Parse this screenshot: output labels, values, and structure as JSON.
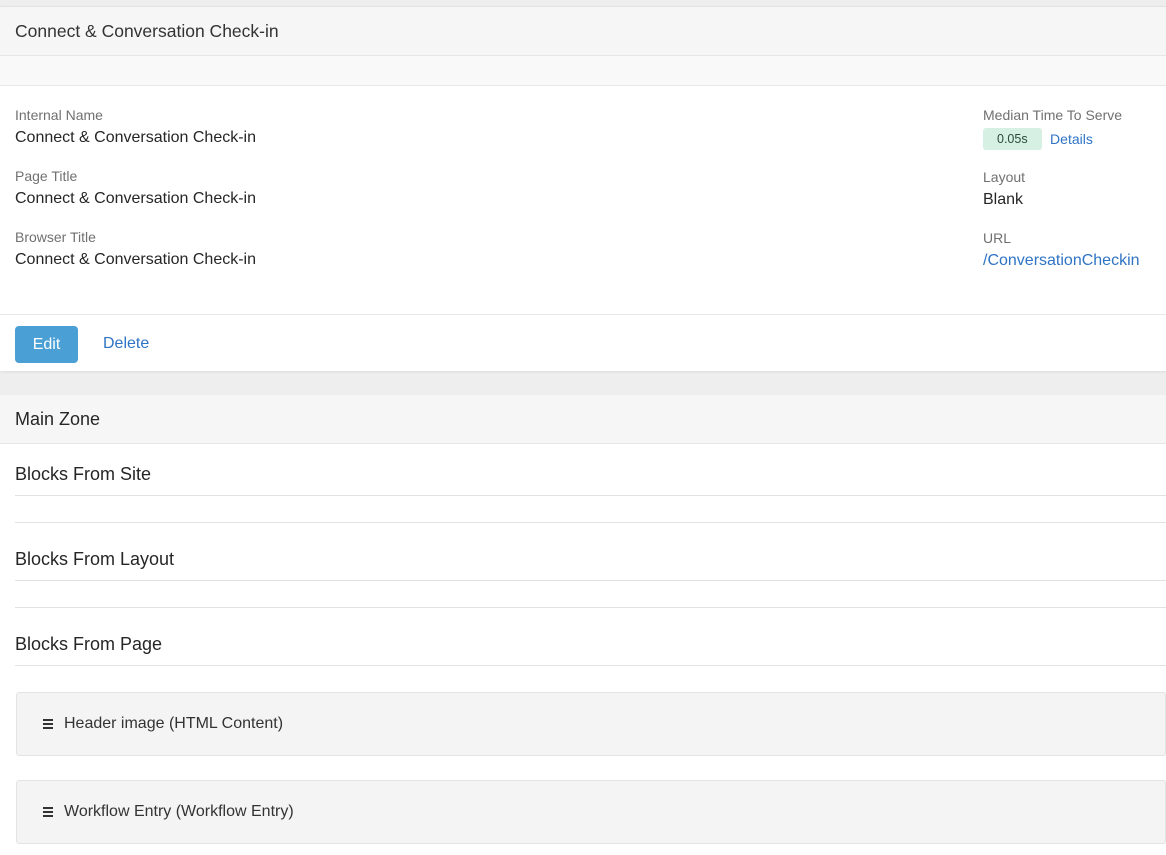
{
  "page": {
    "title": "Connect & Conversation Check-in",
    "fields_left": [
      {
        "label": "Internal Name",
        "value": "Connect & Conversation Check-in"
      },
      {
        "label": "Page Title",
        "value": "Connect & Conversation Check-in"
      },
      {
        "label": "Browser Title",
        "value": "Connect & Conversation Check-in"
      }
    ],
    "median_time": {
      "label": "Median Time To Serve",
      "value": "0.05s",
      "details_link": "Details"
    },
    "layout": {
      "label": "Layout",
      "value": "Blank"
    },
    "url": {
      "label": "URL",
      "value": "/ConversationCheckin"
    },
    "actions": {
      "edit_label": "Edit",
      "delete_label": "Delete"
    }
  },
  "zone": {
    "title": "Main Zone",
    "sections": [
      {
        "title": "Blocks From Site"
      },
      {
        "title": "Blocks From Layout"
      },
      {
        "title": "Blocks From Page"
      }
    ],
    "blocks": [
      {
        "label": "Header image (HTML Content)"
      },
      {
        "label": "Workflow Entry (Workflow Entry)"
      }
    ]
  }
}
